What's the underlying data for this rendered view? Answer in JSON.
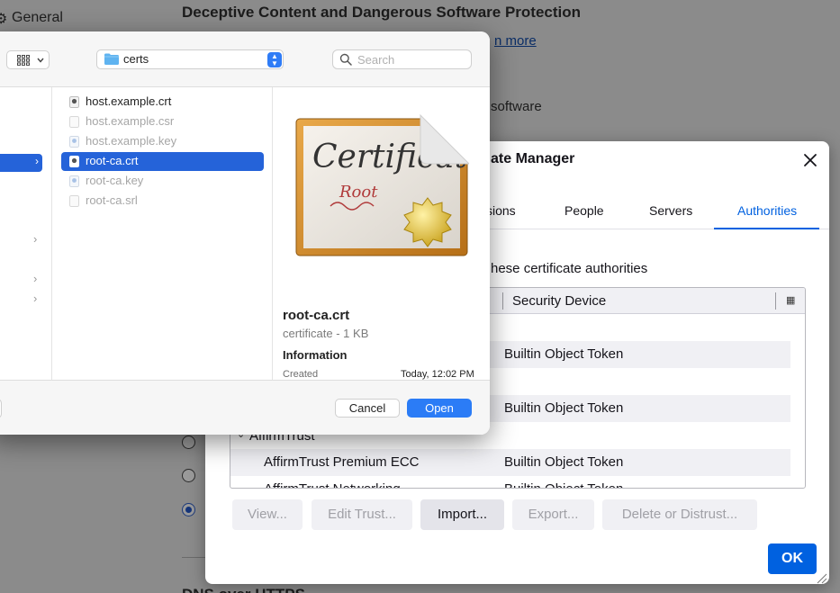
{
  "background": {
    "sidebar_label": "General",
    "heading": "Deceptive Content and Dangerous Software Protection",
    "learn_more": "n more",
    "software_text": "software",
    "bottom_heading": "DNS over HTTPS"
  },
  "cert_manager": {
    "title": "ate Manager",
    "tabs": [
      "sions",
      "People",
      "Servers",
      "Authorities"
    ],
    "active_tab": "Authorities",
    "description": "hese certificate authorities",
    "column_header": "Security Device",
    "rows": [
      {
        "name": "",
        "device": "Builtin Object Token",
        "kind": "cert"
      },
      {
        "name": "",
        "device": "Builtin Object Token",
        "kind": "cert"
      },
      {
        "name": "AffirmTrust",
        "device": "",
        "kind": "group"
      },
      {
        "name": "AffirmTrust Premium ECC",
        "device": "Builtin Object Token",
        "kind": "cert"
      },
      {
        "name": "AffirmTrust Networking",
        "device": "Builtin Object Token",
        "kind": "cert"
      }
    ],
    "buttons": {
      "view": "View...",
      "edit_trust": "Edit Trust...",
      "import": "Import...",
      "export": "Export...",
      "delete": "Delete or Distrust...",
      "ok": "OK"
    },
    "accent_color": "#0061e0"
  },
  "file_dialog": {
    "folder": "certs",
    "search_placeholder": "Search",
    "files": [
      {
        "name": "host.example.crt",
        "state": "normal",
        "icon": "cert-file-icon"
      },
      {
        "name": "host.example.csr",
        "state": "dim",
        "icon": "doc-file-icon"
      },
      {
        "name": "host.example.key",
        "state": "dim",
        "icon": "key-file-icon"
      },
      {
        "name": "root-ca.crt",
        "state": "selected",
        "icon": "cert-file-icon"
      },
      {
        "name": "root-ca.key",
        "state": "dim",
        "icon": "key-file-icon"
      },
      {
        "name": "root-ca.srl",
        "state": "dim",
        "icon": "doc-file-icon"
      }
    ],
    "preview": {
      "image_text": "Certificate",
      "image_subtext": "Root",
      "name": "root-ca.crt",
      "kind": "certificate - 1 KB",
      "info_heading": "Information",
      "created_label": "Created",
      "created_value": "Today, 12:02 PM"
    },
    "buttons": {
      "cancel": "Cancel",
      "open": "Open"
    },
    "accent_color": "#2563d9"
  }
}
